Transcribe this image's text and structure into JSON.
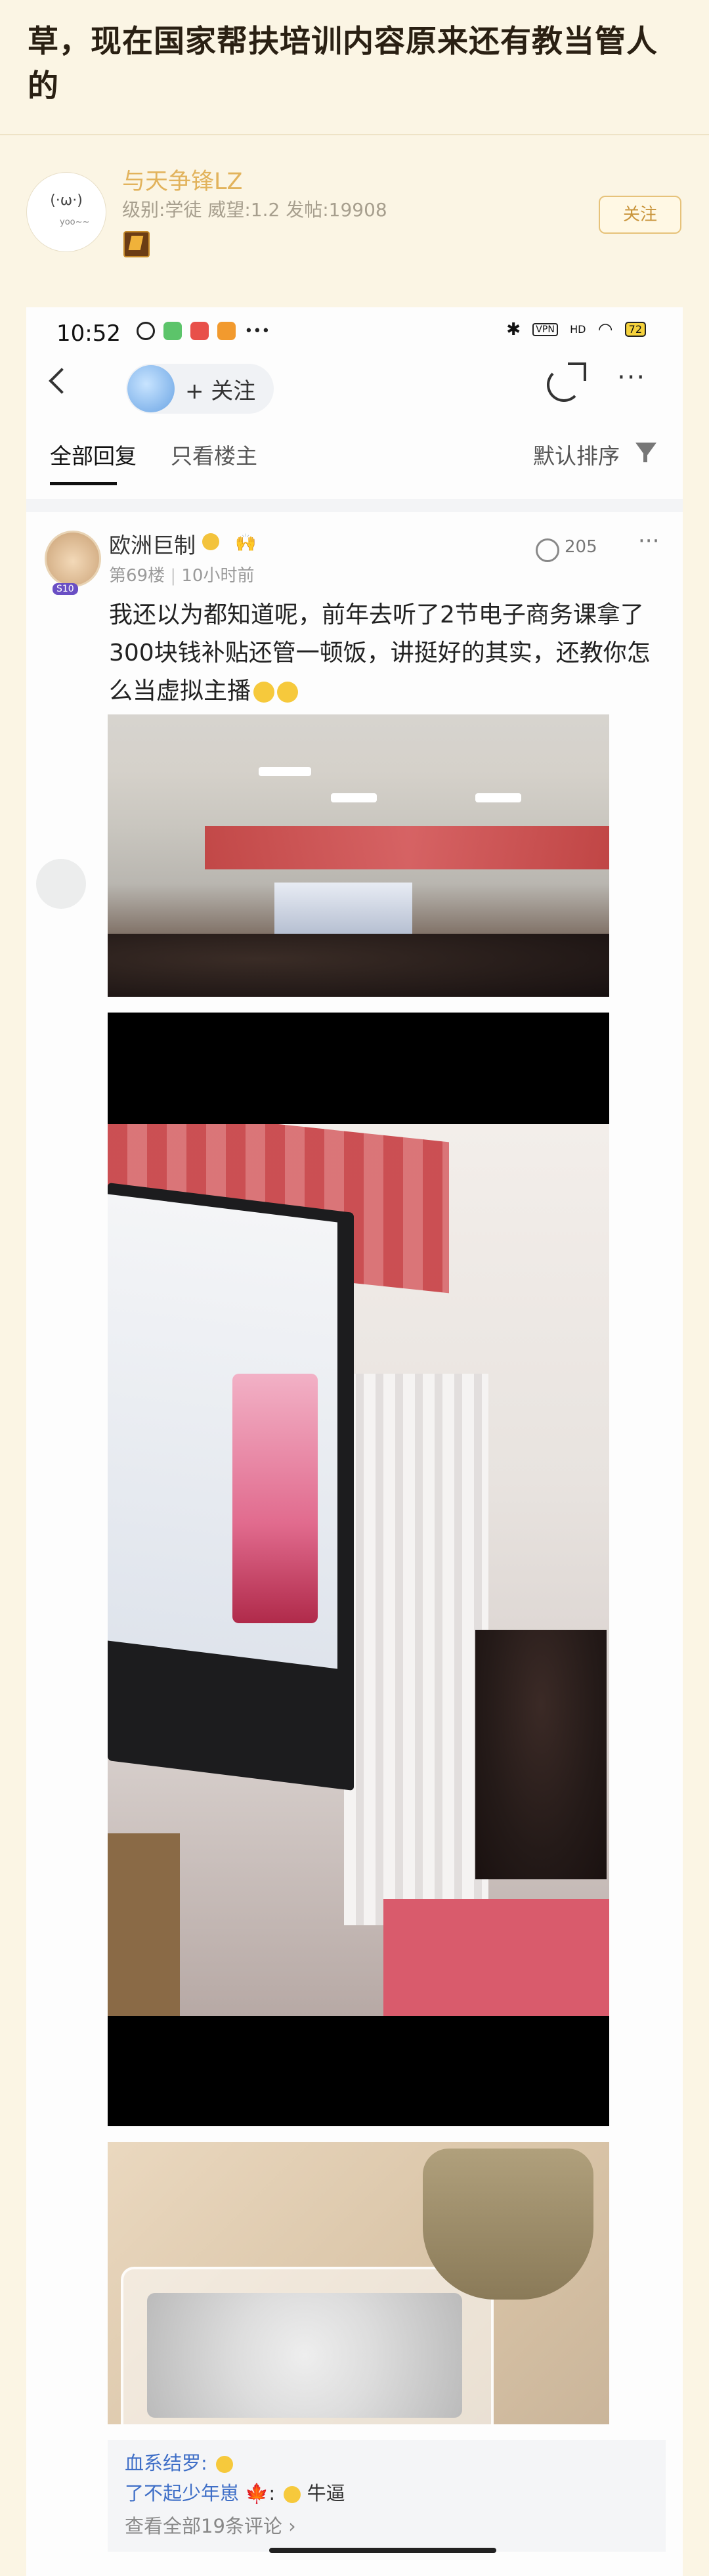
{
  "forum": {
    "title": "草，现在国家帮扶培训内容原来还有教当管人的",
    "poster_name": "与天争锋LZ",
    "poster_meta": "级别:学徒 威望:1.2 发帖:19908",
    "follow_label": "关注",
    "avatar_kaomoji": "(·ω·)",
    "avatar_tag": "yoo~~"
  },
  "phone": {
    "time": "10:52",
    "vpn": "VPN",
    "signal": "HD",
    "battery": "72",
    "follow_label": "+ 关注",
    "tabs": {
      "all": "全部回复",
      "owner": "只看楼主",
      "sort": "默认排序"
    },
    "reply": {
      "name": "欧洲巨制",
      "floor": "第69楼",
      "time": "10小时前",
      "likes": "205",
      "text": "我还以为都知道呢，前年去听了2节电子商务课拿了300块钱补贴还管一顿饭，讲挺好的其实，还教你怎么当虚拟主播",
      "avatar_tag": "S10"
    },
    "subcomments": [
      {
        "user": "血系结罗:",
        "text": ""
      },
      {
        "user": "了不起少年崽",
        "text": "牛逼"
      }
    ],
    "view_all": "查看全部19条评论",
    "more_glyph": "···"
  },
  "colors": {
    "bg": "#fbf5e4",
    "accent": "#e2b35c",
    "link": "#3e6ec7"
  }
}
